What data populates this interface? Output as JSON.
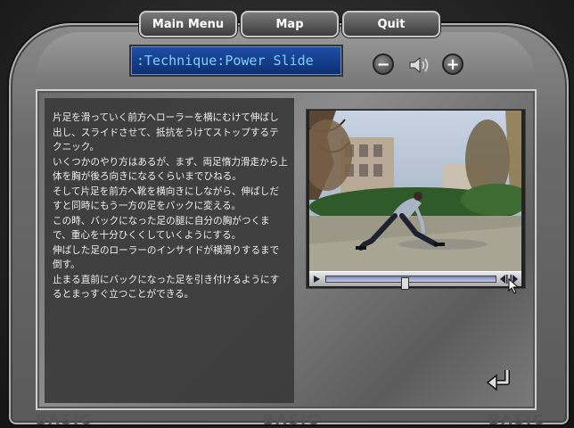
{
  "nav": {
    "main_menu": "Main Menu",
    "map": "Map",
    "quit": "Quit"
  },
  "title": ":Technique:Power Slide",
  "volume": {
    "minus_label": "−",
    "plus_label": "+"
  },
  "description": [
    "片足を滑っていく前方へローラーを横にむけて伸ばし出し、スライドさせて、抵抗をうけてストップするテクニック。",
    "いくつかのやり方はあるが、まず、両足惰力滑走から上体を胸が後ろ向きになるくらいまでひねる。",
    "そして片足を前方へ靴を横向きにしながら、伸ばしだすと同時にもう一方の足をバックに変える。",
    "この時、バックになった足の腿に自分の胸がつくまで、重心を十分ひくくしていくようにする。",
    "伸ばした足のローラーのインサイドが横滑りするまで倒す。",
    "止まる直前にバックになった足を引き付けるようにするとまっすぐ立つことができる。"
  ],
  "video": {
    "progress": 0.46
  },
  "background_text": {
    "basic": "BASIC"
  },
  "colors": {
    "title_text": "#7fd0ff",
    "title_bg": "#1e4fa8"
  }
}
